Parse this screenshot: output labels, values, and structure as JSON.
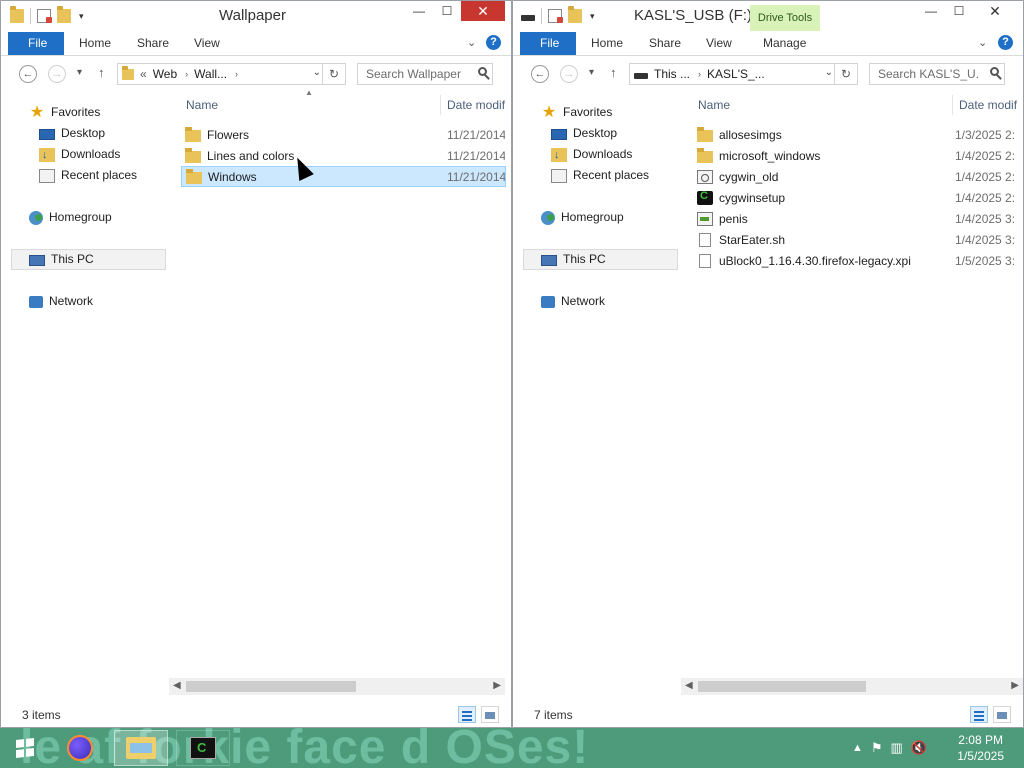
{
  "left_window": {
    "title": "Wallpaper",
    "ribbon_tabs": [
      "File",
      "Home",
      "Share",
      "View"
    ],
    "address": {
      "prefix": "«",
      "segments": [
        "Web",
        "Wall..."
      ]
    },
    "search_placeholder": "Search Wallpaper",
    "columns": [
      "Name",
      "Date modif"
    ],
    "files": [
      {
        "name": "Flowers",
        "type": "folder",
        "date": "11/21/2014"
      },
      {
        "name": "Lines and colors",
        "type": "folder",
        "date": "11/21/2014"
      },
      {
        "name": "Windows",
        "type": "folder",
        "date": "11/21/2014",
        "selected": true
      }
    ],
    "status": "3 items"
  },
  "right_window": {
    "title": "KASL'S_USB (F:)",
    "context_tab": "Drive Tools",
    "ribbon_tabs": [
      "File",
      "Home",
      "Share",
      "View",
      "Manage"
    ],
    "address": {
      "segments": [
        "This ...",
        "KASL'S_..."
      ]
    },
    "search_placeholder": "Search KASL'S_U...",
    "columns": [
      "Name",
      "Date modif"
    ],
    "files": [
      {
        "name": "allosesimgs",
        "type": "folder",
        "date": "1/3/2025 2:"
      },
      {
        "name": "microsoft_windows",
        "type": "folder",
        "date": "1/4/2025 2:"
      },
      {
        "name": "cygwin_old",
        "type": "exe-old",
        "date": "1/4/2025 2:"
      },
      {
        "name": "cygwinsetup",
        "type": "cyg",
        "date": "1/4/2025 2:"
      },
      {
        "name": "penis",
        "type": "penis",
        "date": "1/4/2025 3:"
      },
      {
        "name": "StarEater.sh",
        "type": "file",
        "date": "1/4/2025 3:"
      },
      {
        "name": "uBlock0_1.16.4.30.firefox-legacy.xpi",
        "type": "file",
        "date": "1/5/2025 3:"
      }
    ],
    "status": "7 items"
  },
  "nav_pane": {
    "favorites": "Favorites",
    "desktop": "Desktop",
    "downloads": "Downloads",
    "recent": "Recent places",
    "homegroup": "Homegroup",
    "this_pc": "This PC",
    "network": "Network"
  },
  "taskbar": {
    "wallpaper_text": "le af forkie face   d OSes!",
    "time": "2:08 PM",
    "date": "1/5/2025"
  }
}
